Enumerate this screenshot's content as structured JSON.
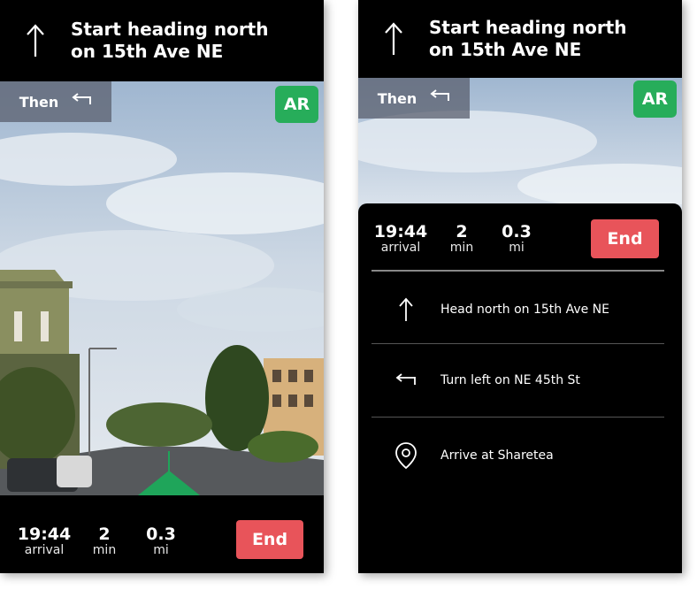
{
  "nav": {
    "instruction": "Start heading north on 15th Ave NE",
    "then_label": "Then",
    "ar_label": "AR"
  },
  "trip": {
    "arrival_value": "19:44",
    "arrival_label": "arrival",
    "duration_value": "2",
    "duration_label": "min",
    "distance_value": "0.3",
    "distance_label": "mi",
    "end_label": "End"
  },
  "steps": [
    {
      "icon": "arrow-up-icon",
      "text": "Head north on 15th Ave NE"
    },
    {
      "icon": "turn-left-icon",
      "text": "Turn left on NE 45th St"
    },
    {
      "icon": "location-pin-icon",
      "text": "Arrive at Sharetea"
    }
  ],
  "colors": {
    "ar_green": "#27ad5a",
    "end_red": "#e8545a",
    "route_arrow": "#1fa55a"
  }
}
